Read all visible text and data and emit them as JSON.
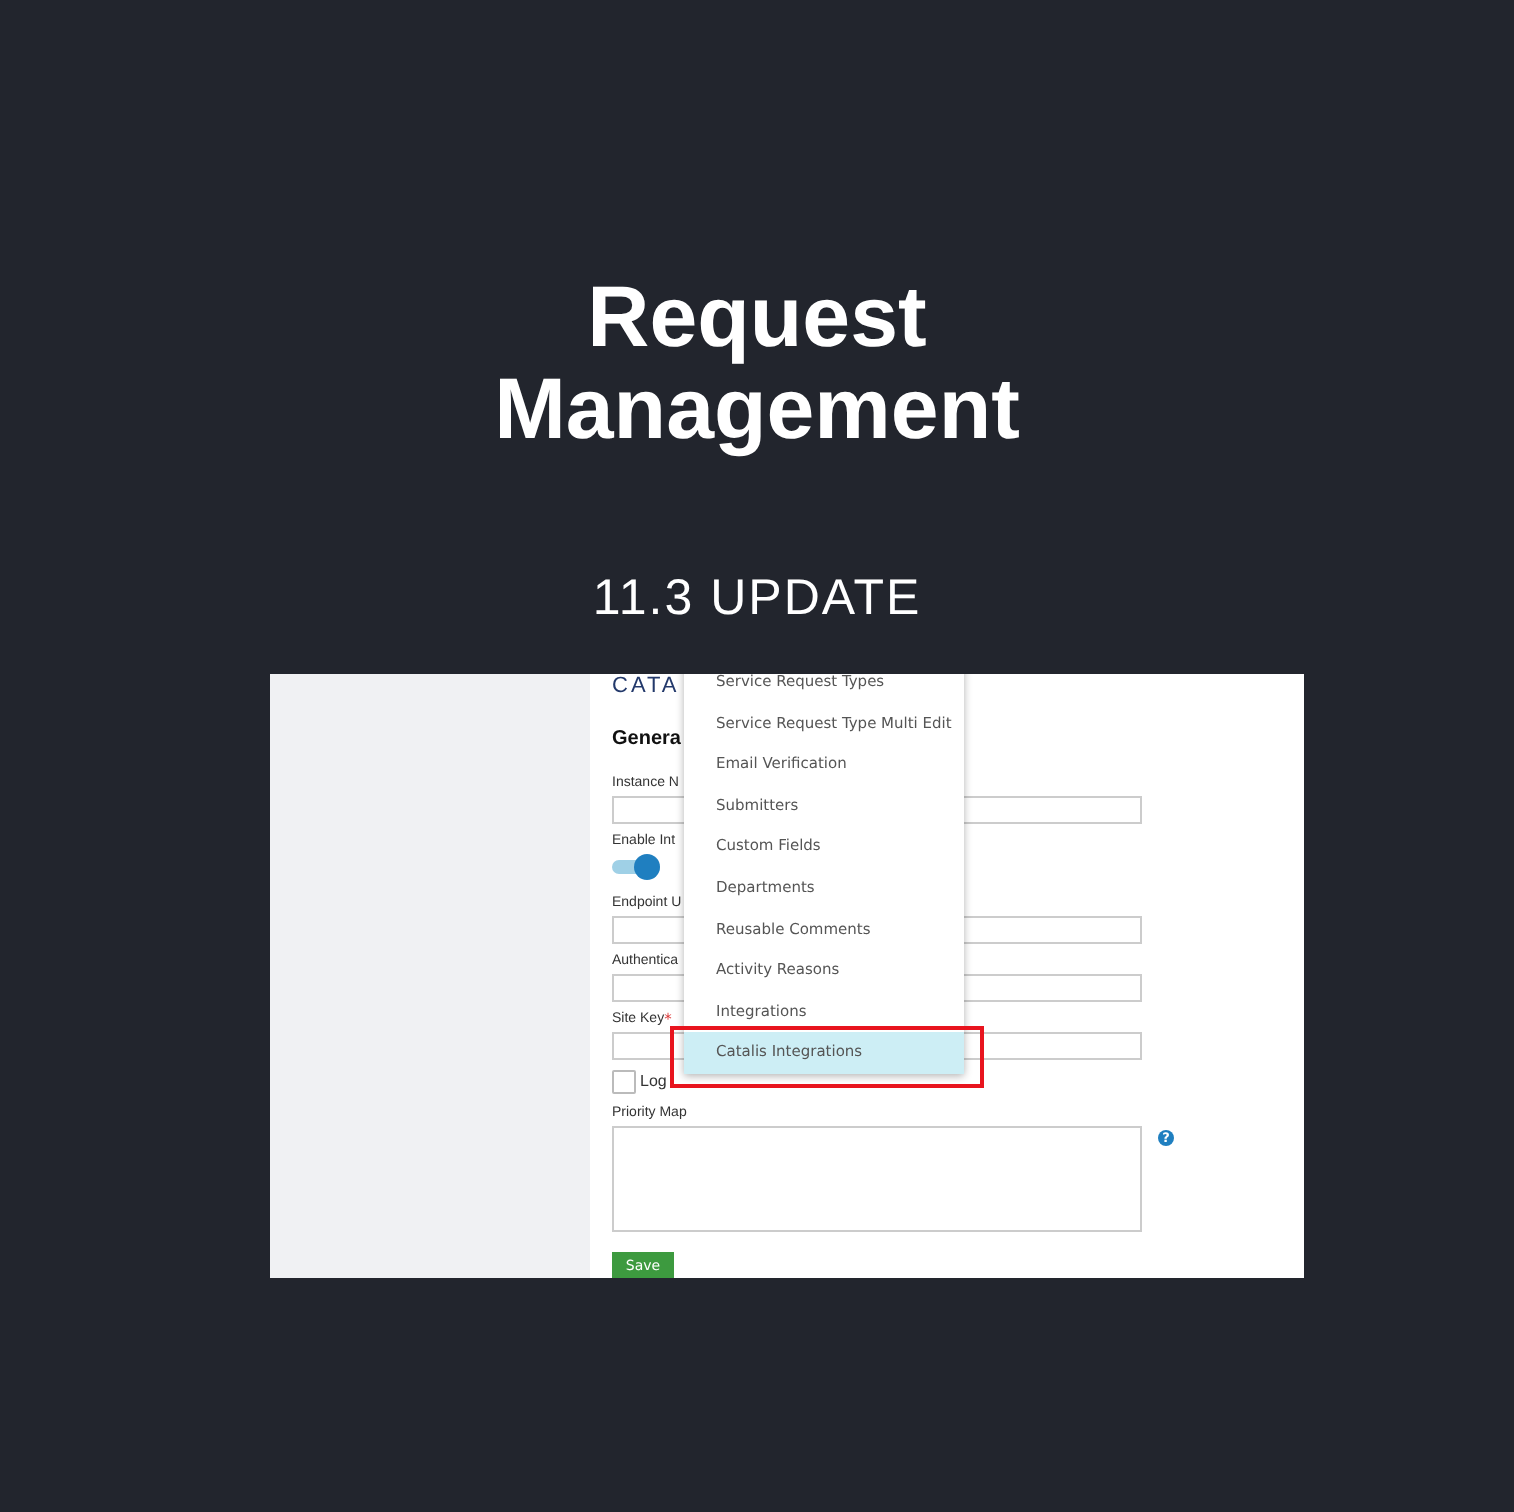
{
  "title": "Request Management",
  "subtitle": "11.3 UPDATE",
  "screenshot": {
    "logo": "CATA",
    "heading": "Genera",
    "fields": [
      {
        "kind": "text",
        "label": "Instance N"
      },
      {
        "kind": "toggle",
        "label": "Enable Int",
        "on": true
      },
      {
        "kind": "text",
        "label": "Endpoint U"
      },
      {
        "kind": "text",
        "label": "Authentica"
      },
      {
        "kind": "text",
        "label": "Site Key",
        "required_mark": "*"
      },
      {
        "kind": "checkbox",
        "label": "Log",
        "checked": false
      },
      {
        "kind": "textarea",
        "label": "Priority Map",
        "help": "?"
      }
    ],
    "save": "Save",
    "menu": [
      {
        "label": "Service Request Types",
        "selected": false
      },
      {
        "label": "Service Request Type Multi Edit",
        "selected": false
      },
      {
        "label": "Email Verification",
        "selected": false
      },
      {
        "label": "Submitters",
        "selected": false
      },
      {
        "label": "Custom Fields",
        "selected": false
      },
      {
        "label": "Departments",
        "selected": false
      },
      {
        "label": "Reusable Comments",
        "selected": false
      },
      {
        "label": "Activity Reasons",
        "selected": false
      },
      {
        "label": "Integrations",
        "selected": false
      },
      {
        "label": "Catalis Integrations",
        "selected": true
      }
    ],
    "highlight": true
  }
}
